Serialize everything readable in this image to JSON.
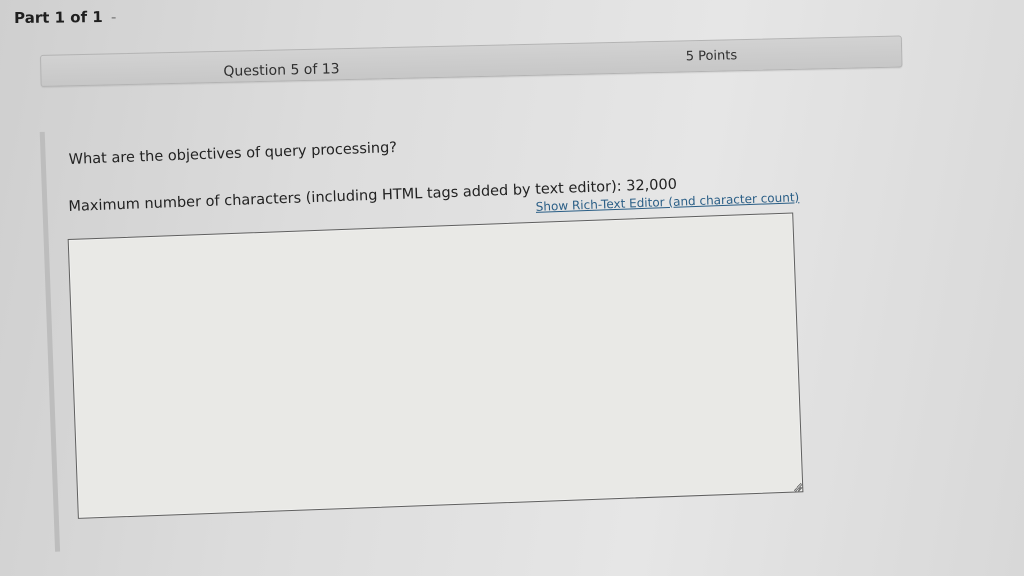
{
  "part": {
    "title": "Part 1 of 1",
    "separator": "-"
  },
  "question": {
    "number_label": "Question 5 of 13",
    "points_label": "5 Points",
    "prompt": "What are the objectives of query processing?",
    "max_chars_label": "Maximum number of characters (including HTML tags added by text editor): 32,000",
    "rich_text_link": "Show Rich-Text Editor (and character count)",
    "answer_value": ""
  },
  "icons": {
    "resize_grip": "resize-grip-icon"
  }
}
